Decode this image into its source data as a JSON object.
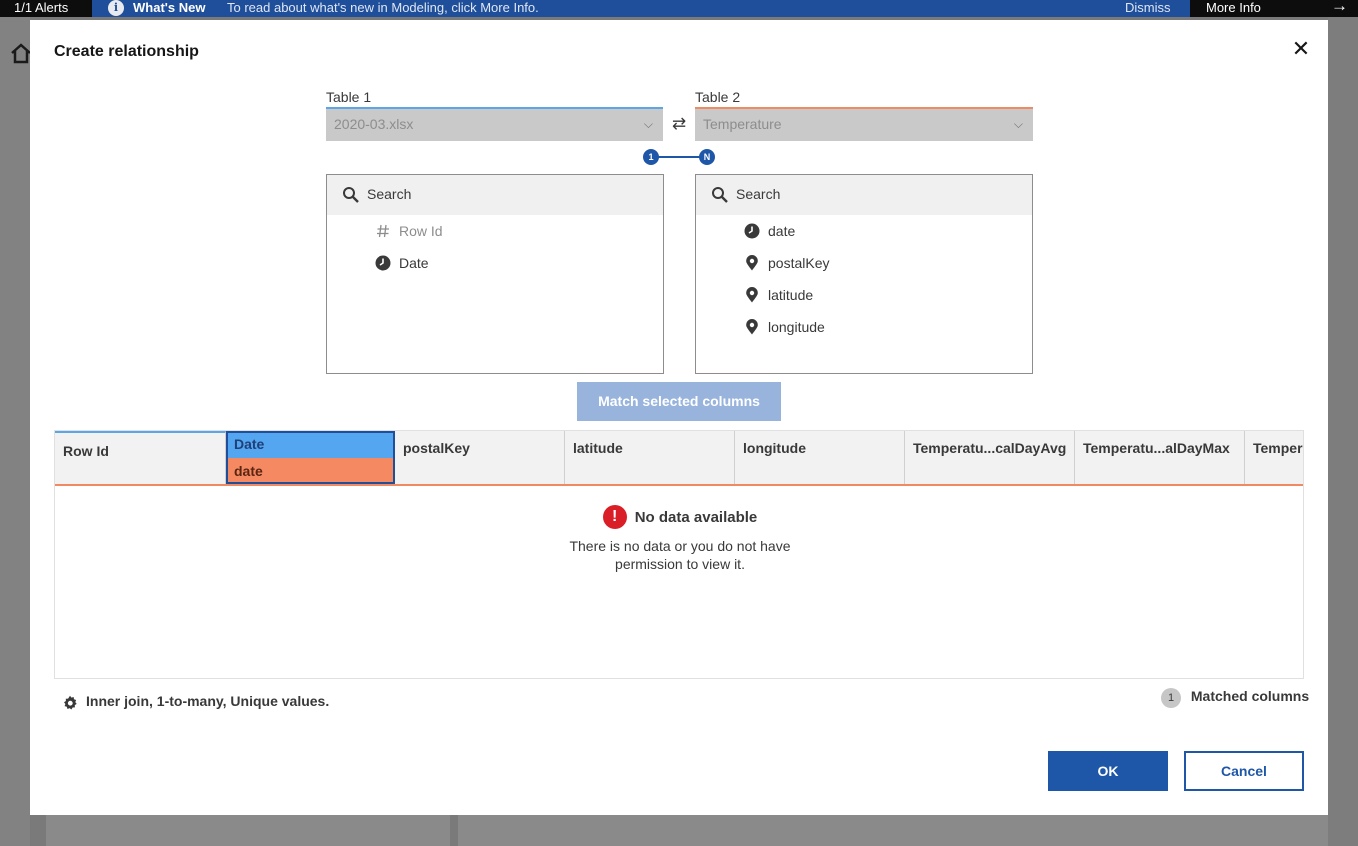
{
  "alert_bar": {
    "alerts_count": "1/1 Alerts",
    "whats_new": "What's New",
    "message": "To read about what's new in Modeling, click More Info.",
    "dismiss": "Dismiss",
    "more_info": "More Info"
  },
  "dialog": {
    "title": "Create relationship",
    "table1": {
      "label": "Table 1",
      "value": "2020-03.xlsx"
    },
    "table2": {
      "label": "Table 2",
      "value": "Temperature"
    },
    "cardinality": {
      "left": "1",
      "right": "N"
    },
    "search_placeholder": "Search",
    "table1_columns": [
      {
        "name": "Row Id",
        "icon": "hash-icon"
      },
      {
        "name": "Date",
        "icon": "clock-icon"
      }
    ],
    "table2_columns": [
      {
        "name": "date",
        "icon": "clock-icon"
      },
      {
        "name": "postalKey",
        "icon": "location-pin-icon"
      },
      {
        "name": "latitude",
        "icon": "location-pin-icon"
      },
      {
        "name": "longitude",
        "icon": "location-pin-icon"
      }
    ],
    "match_button": "Match selected columns",
    "grid_headers": {
      "row_id": "Row Id",
      "matched_top": "Date",
      "matched_bottom": "date",
      "c3": "postalKey",
      "c4": "latitude",
      "c5": "longitude",
      "c6": "Temperatu...calDayAvg",
      "c7": "Temperatu...alDayMax",
      "c8": "Temper"
    },
    "no_data_title": "No data available",
    "no_data_line1": "There is no data or you do not have",
    "no_data_line2": "permission to view it.",
    "join_settings": "Inner join, 1-to-many, Unique values.",
    "matched_count": "1",
    "matched_label": "Matched columns",
    "ok": "OK",
    "cancel": "Cancel"
  },
  "colors": {
    "primary": "#1f57a8",
    "table1_accent": "#54a6f0",
    "table2_accent": "#f58a62",
    "error": "#da1e28"
  }
}
